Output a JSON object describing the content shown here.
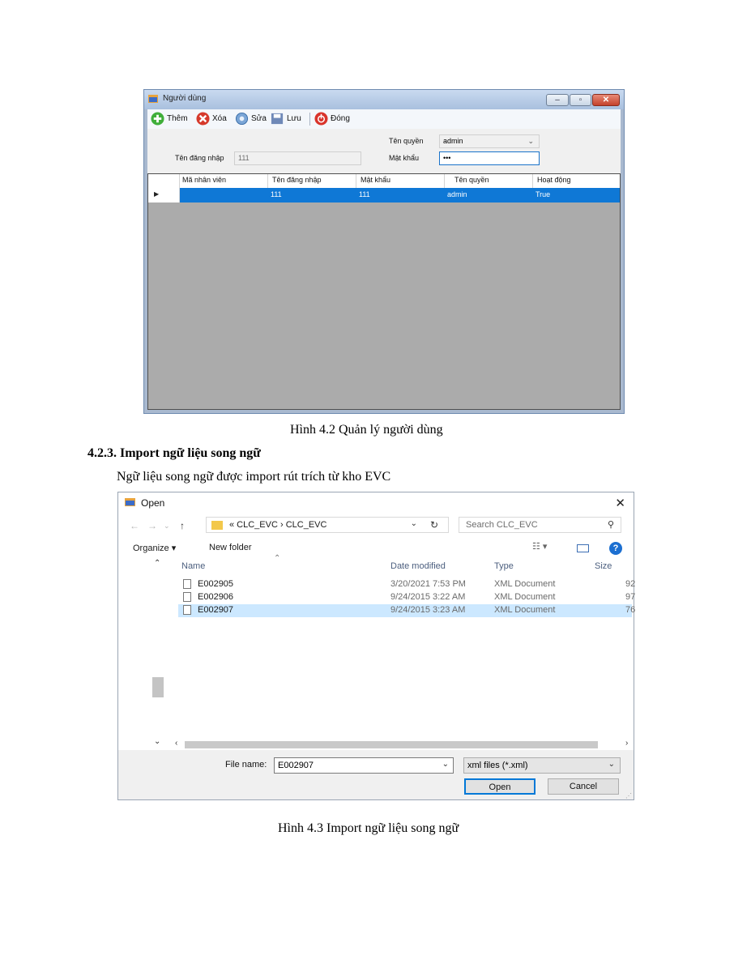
{
  "user_window": {
    "title": "Người dùng",
    "toolbar": {
      "add_label": "Thêm",
      "delete_label": "Xóa",
      "edit_label": "Sửa",
      "save_label": "Lưu",
      "close_label": "Đóng"
    },
    "form": {
      "role_label": "Tên quyền",
      "role_value": "admin",
      "username_label": "Tên đăng nhập",
      "username_value": "111",
      "password_label": "Mật khẩu",
      "password_value": "•••"
    },
    "grid": {
      "columns": [
        "Mã nhân viên",
        "Tên đăng nhập",
        "Mật khẩu",
        "Tên quyền",
        "Hoạt động"
      ],
      "rows": [
        {
          "employee_id": "",
          "username": "111",
          "password": "111",
          "role": "admin",
          "active": "True"
        }
      ]
    }
  },
  "caption_1": "Hình 4.2 Quản lý người dùng",
  "section_heading": "4.2.3. Import ngữ liệu song ngữ",
  "paragraph": "Ngữ liệu song ngữ được import rút trích từ kho EVC",
  "open_dialog": {
    "title": "Open",
    "breadcrumb": "«  CLC_EVC  ›  CLC_EVC",
    "search_placeholder": "Search CLC_EVC",
    "organize_label": "Organize ▾",
    "new_folder_label": "New folder",
    "columns": {
      "name": "Name",
      "date": "Date modified",
      "type": "Type",
      "size": "Size"
    },
    "files": [
      {
        "name": "E002905",
        "date": "3/20/2021 7:53 PM",
        "type": "XML Document",
        "size": "92"
      },
      {
        "name": "E002906",
        "date": "9/24/2015 3:22 AM",
        "type": "XML Document",
        "size": "97"
      },
      {
        "name": "E002907",
        "date": "9/24/2015 3:23 AM",
        "type": "XML Document",
        "size": "76"
      }
    ],
    "file_name_label": "File name:",
    "file_name_value": "E002907",
    "filter_value": "xml files (*.xml)",
    "open_button": "Open",
    "cancel_button": "Cancel"
  },
  "caption_2": "Hình 4.3 Import ngữ liệu song ngữ"
}
